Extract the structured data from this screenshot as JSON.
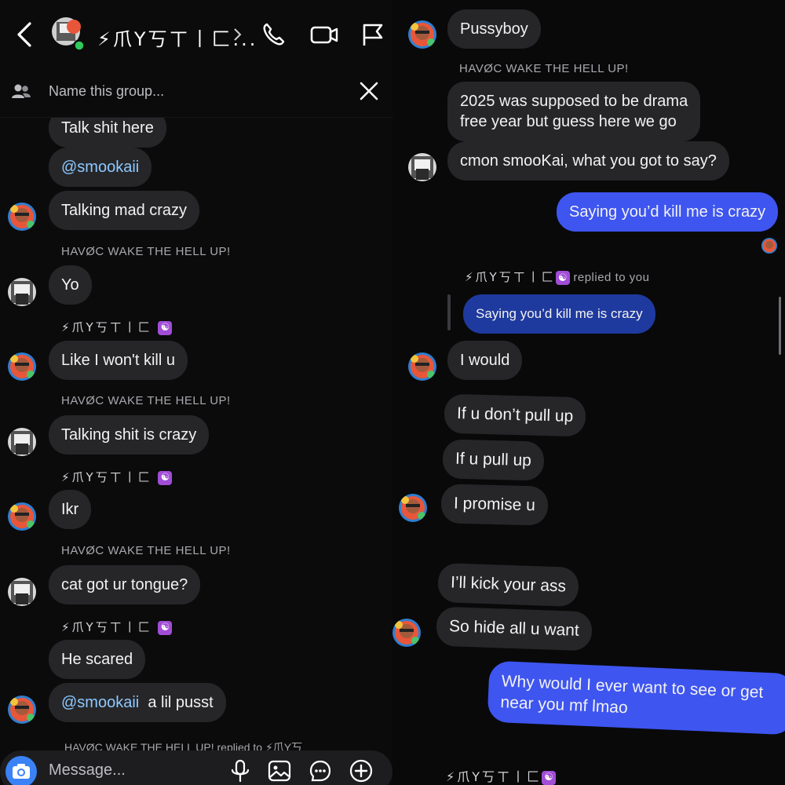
{
  "header": {
    "title": "⚡爪Y丂ㄒ丨匚...",
    "group_name_placeholder": "Name this group..."
  },
  "left_messages": {
    "m1": "Talk shit here",
    "m2": "@smookaii",
    "m3": "Talking mad crazy",
    "s1": "HAVØC WAKE THE HELL UP!",
    "m4": "Yo",
    "s2": "⚡爪Y丂ㄒ丨匚",
    "m5": "Like I won't kill u",
    "s3": "HAVØC WAKE THE HELL UP!",
    "m6": "Talking shit is crazy",
    "s4": "⚡爪Y丂ㄒ丨匚",
    "m7": "Ikr",
    "s5": "HAVØC WAKE THE HELL UP!",
    "m8": "cat got ur tongue?",
    "s6": "⚡爪Y丂ㄒ丨匚",
    "m9": "He scared",
    "m10_mention": "@smookaii",
    "m10_text": "a lil pusst",
    "cut_sender": "HAVØC WAKE THE HELL UP! replied to ⚡爪Y丂"
  },
  "composer": {
    "placeholder": "Message..."
  },
  "right_messages": {
    "r1": "Pussyboy",
    "s1": "HAVØC WAKE THE HELL UP!",
    "r2_line1": "2025 was supposed to be drama",
    "r2_line2": "free year but guess here we go",
    "r3": "cmon smooKai, what you got to say?",
    "r4": "Saying you’d kill me is crazy",
    "reply_sender": "⚡爪Y丂ㄒ丨匚",
    "reply_label": "replied to you",
    "reply_quote": "Saying you’d kill me is crazy",
    "r5": "I would",
    "r6": "If u don’t pull up",
    "r7": "If u pull up",
    "r8": "I promise u",
    "r9": "I’ll kick your ass",
    "r10": "So hide all u want",
    "r11_line1": "Why would I ever want to see or get",
    "r11_line2": "near you mf lmao",
    "s_bottom": "⚡爪Y丂ㄒ丨匚"
  },
  "colors": {
    "bubble_other": "#262629",
    "bubble_me": "#3e55f0",
    "mention": "#8ec9ff",
    "online": "#30c85a"
  }
}
